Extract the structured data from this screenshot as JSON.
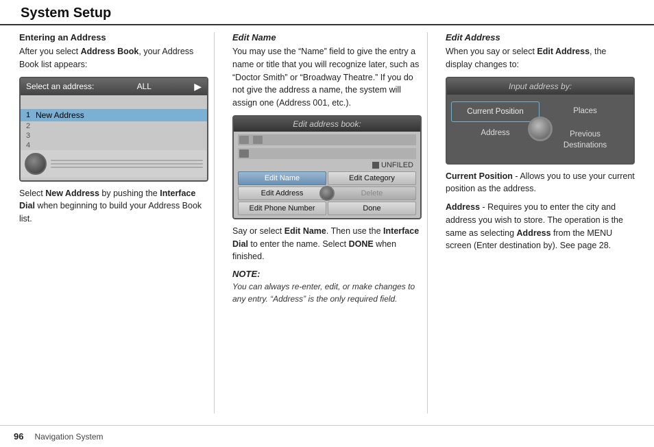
{
  "header": {
    "title": "System Setup"
  },
  "col1": {
    "section_title": "Entering an Address",
    "intro": "After you select ",
    "address_book_bold": "Address Book",
    "intro_end": ", your Address Book list appears:",
    "screen": {
      "header_label": "Select an address:",
      "filter_label": "ALL",
      "rows": [
        {
          "num": "1",
          "label": "New Address",
          "selected": true
        },
        {
          "num": "2",
          "label": "",
          "selected": false
        },
        {
          "num": "3",
          "label": "",
          "selected": false
        },
        {
          "num": "4",
          "label": "",
          "selected": false
        }
      ]
    },
    "instruction_start": "Select ",
    "new_address_bold": "New Address",
    "instruction_mid": " by pushing the ",
    "interface_dial_bold": "Interface Dial",
    "instruction_end": " when beginning to build your Address Book list."
  },
  "col2": {
    "section_title": "Edit Name",
    "body1": "You may use the “Name” field to give the entry a name or title that you will recognize later, such as “Doctor Smith” or “Broadway Theatre.” If you do not give the address a name, the system will assign one (Address 001, etc.).",
    "screen": {
      "header_label": "Edit address book:",
      "icons_count": 3,
      "unfiled_label": "UNFILED",
      "buttons": [
        {
          "label": "Edit Name",
          "state": "active"
        },
        {
          "label": "Edit Category",
          "state": "normal"
        },
        {
          "label": "Edit Address",
          "state": "normal"
        },
        {
          "label": "Delete",
          "state": "disabled"
        },
        {
          "label": "Edit Phone Number",
          "state": "normal"
        },
        {
          "label": "Done",
          "state": "normal"
        }
      ]
    },
    "instruction_start": "Say or select ",
    "edit_name_bold": "Edit Name",
    "instruction_mid": ". Then use the ",
    "interface_dial_bold": "Interface Dial",
    "instruction_mid2": " to enter the name. Select ",
    "done_bold": "DONE",
    "instruction_end": " when finished.",
    "note_title": "NOTE:",
    "note_text": "You can always re-enter, edit, or make changes to any entry. “Address” is the only required field."
  },
  "col3": {
    "section_title": "Edit Address",
    "intro_start": "When you say or select ",
    "edit_address_bold": "Edit Address",
    "intro_end": ", the display changes to:",
    "screen": {
      "header_label": "Input address by:",
      "buttons": [
        {
          "label": "Current Position",
          "position": "top-left",
          "highlighted": true
        },
        {
          "label": "Places",
          "position": "top-right"
        },
        {
          "label": "Address",
          "position": "bottom-left"
        },
        {
          "label": "Previous\nDestinations",
          "position": "bottom-right"
        }
      ]
    },
    "current_position_bold": "Current Position",
    "current_position_desc": " - Allows you to use your current position as the address.",
    "address_bold": "Address",
    "address_desc": " - Requires you to enter the city and address you wish to store. The operation is the same as selecting ",
    "address_bold2": "Address",
    "address_desc2": " from the MENU screen (Enter destination by). See page 28."
  },
  "footer": {
    "page_number": "96",
    "nav_system": "Navigation System"
  }
}
